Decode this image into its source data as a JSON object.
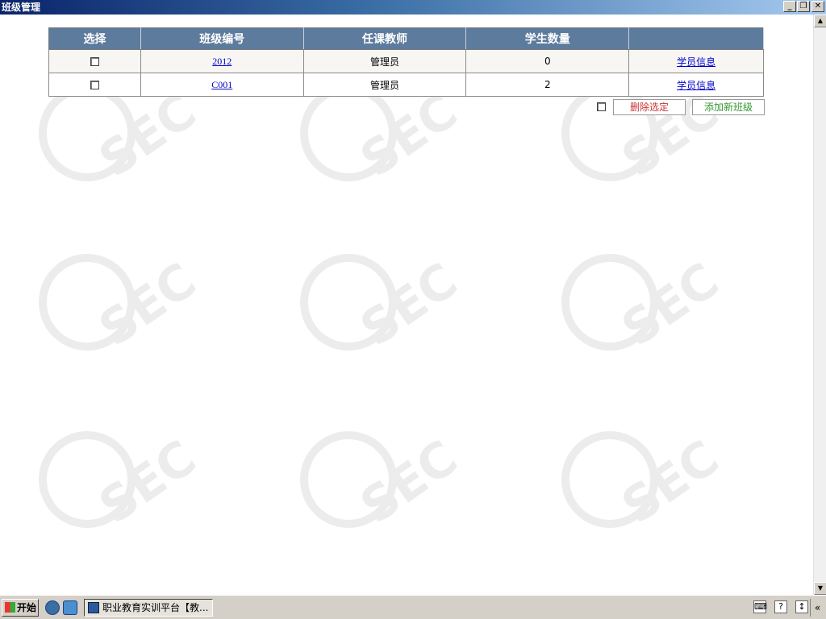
{
  "window": {
    "title": "班级管理"
  },
  "table": {
    "headers": [
      "选择",
      "班级编号",
      "任课教师",
      "学生数量",
      ""
    ],
    "rows": [
      {
        "class_id": "2012",
        "teacher": "管理员",
        "count": "0",
        "info": "学员信息"
      },
      {
        "class_id": "C001",
        "teacher": "管理员",
        "count": "2",
        "info": "学员信息"
      }
    ]
  },
  "actions": {
    "delete_label": "删除选定",
    "add_label": "添加新班级"
  },
  "taskbar": {
    "start_label": "开始",
    "task_label": "职业教育实训平台【教..."
  },
  "watermark": {
    "text": "Q-SEC"
  }
}
